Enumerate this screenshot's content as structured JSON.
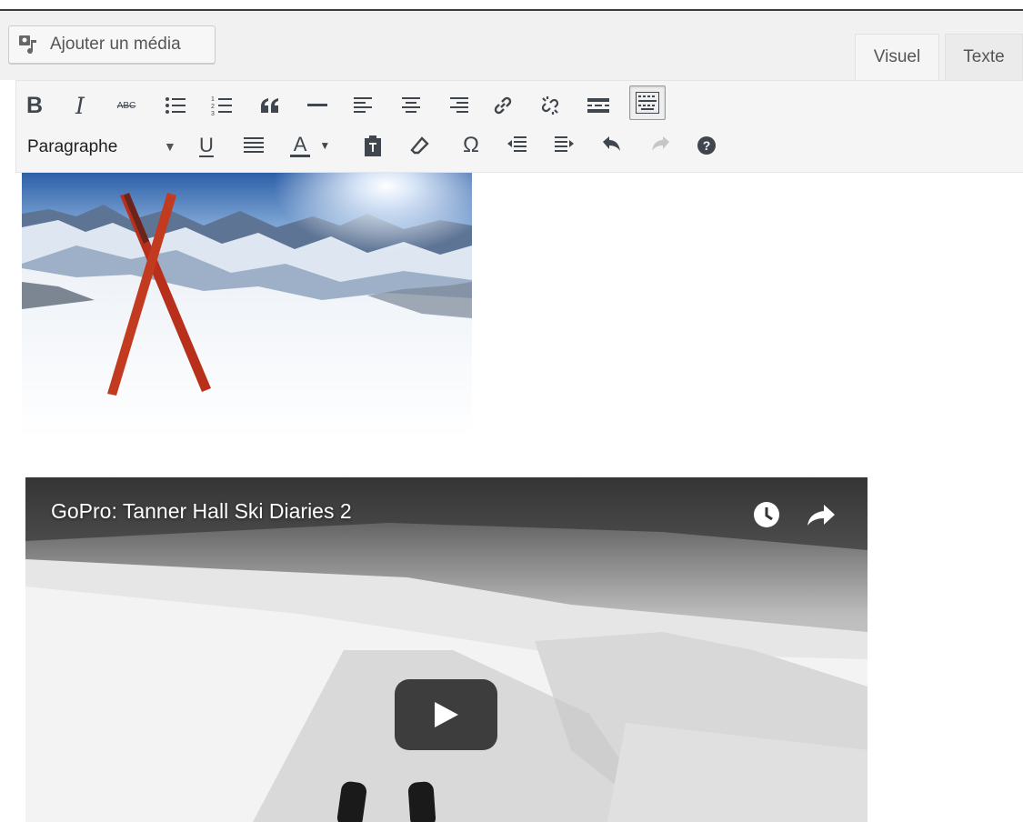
{
  "editor": {
    "add_media_label": "Ajouter un média",
    "tabs": [
      {
        "label": "Visuel",
        "active": true
      },
      {
        "label": "Texte",
        "active": false
      }
    ]
  },
  "toolbar": {
    "row1": [
      "bold",
      "italic",
      "strikethrough",
      "bulleted-list",
      "numbered-list",
      "blockquote",
      "horizontal-line",
      "align-left",
      "align-center",
      "align-right",
      "insert-link",
      "remove-link",
      "read-more",
      "toolbar-toggle"
    ],
    "row2": [
      "format",
      "underline",
      "justify",
      "text-color",
      "paste-as-text",
      "clear-formatting",
      "special-character",
      "decrease-indent",
      "increase-indent",
      "undo",
      "redo",
      "help"
    ],
    "bold_glyph": "B",
    "italic_glyph": "I",
    "strike_glyph": "ABC",
    "underline_glyph": "U",
    "text_color_glyph": "A",
    "omega_glyph": "Ω",
    "format_value": "Paragraphe"
  },
  "content": {
    "video_title": "GoPro: Tanner Hall Ski Diaries 2"
  },
  "colors": {
    "accent_red": "#b8301c",
    "toolbar_bg": "#f5f5f5"
  }
}
